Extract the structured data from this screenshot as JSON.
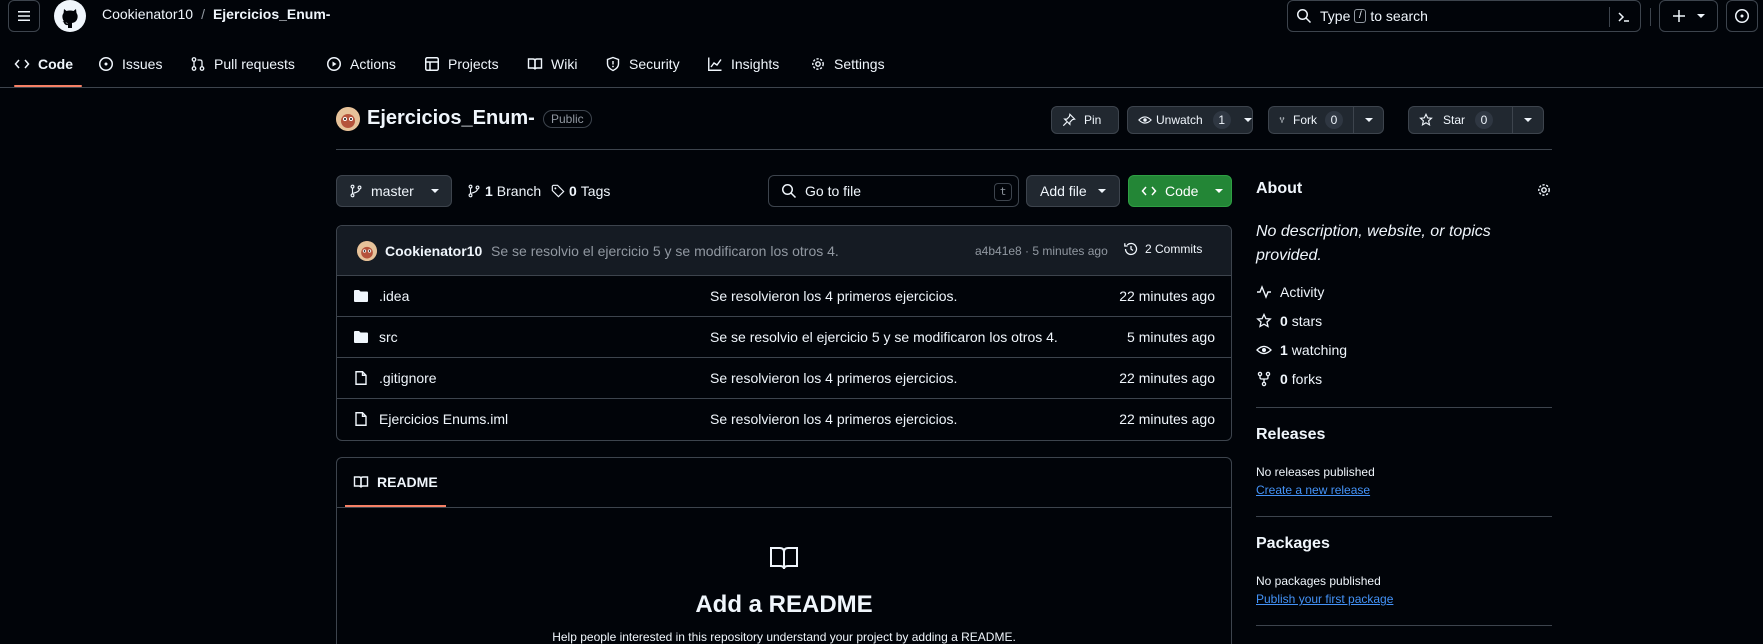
{
  "header": {
    "owner": "Cookienator10",
    "separator": "/",
    "repo": "Ejercicios_Enum-",
    "search": {
      "prefix": "Type",
      "key": "/",
      "suffix": "to search"
    }
  },
  "tabs": [
    {
      "label": "Code",
      "icon": "code-icon"
    },
    {
      "label": "Issues",
      "icon": "issue-opened-icon"
    },
    {
      "label": "Pull requests",
      "icon": "git-pull-request-icon"
    },
    {
      "label": "Actions",
      "icon": "play-icon"
    },
    {
      "label": "Projects",
      "icon": "table-icon"
    },
    {
      "label": "Wiki",
      "icon": "book-icon"
    },
    {
      "label": "Security",
      "icon": "shield-icon"
    },
    {
      "label": "Insights",
      "icon": "graph-icon"
    },
    {
      "label": "Settings",
      "icon": "gear-icon"
    }
  ],
  "repo": {
    "name": "Ejercicios_Enum-",
    "visibility": "Public",
    "pin_label": "Pin",
    "watch_label": "Unwatch",
    "watch_count": "1",
    "fork_label": "Fork",
    "fork_count": "0",
    "star_label": "Star",
    "star_count": "0"
  },
  "filenav": {
    "branch": "master",
    "branch_count": "1",
    "branch_label": "Branch",
    "tag_count": "0",
    "tag_label": "Tags",
    "goto_placeholder": "Go to file",
    "goto_key": "t",
    "add_file": "Add file",
    "code": "Code"
  },
  "commit": {
    "author": "Cookienator10",
    "message": "Se se resolvio el ejercicio 5 y se modificaron los otros 4.",
    "meta": "a4b41e8 · 5 minutes ago",
    "count": "2 Commits"
  },
  "files": [
    {
      "type": "folder",
      "name": ".idea",
      "message": "Se resolvieron los 4 primeros ejercicios.",
      "time": "22 minutes ago"
    },
    {
      "type": "folder",
      "name": "src",
      "message": "Se se resolvio el ejercicio 5 y se modificaron los otros 4.",
      "time": "5 minutes ago"
    },
    {
      "type": "file",
      "name": ".gitignore",
      "message": "Se resolvieron los 4 primeros ejercicios.",
      "time": "22 minutes ago"
    },
    {
      "type": "file",
      "name": "Ejercicios Enums.iml",
      "message": "Se resolvieron los 4 primeros ejercicios.",
      "time": "22 minutes ago"
    }
  ],
  "readme": {
    "tab": "README",
    "title": "Add a README",
    "help": "Help people interested in this repository understand your project by adding a README."
  },
  "about": {
    "title": "About",
    "description": "No description, website, or topics provided.",
    "activity": "Activity",
    "stars_count": "0",
    "stars_label": "stars",
    "watching_count": "1",
    "watching_label": "watching",
    "forks_count": "0",
    "forks_label": "forks"
  },
  "releases": {
    "title": "Releases",
    "empty": "No releases published",
    "link": "Create a new release"
  },
  "packages": {
    "title": "Packages",
    "empty": "No packages published",
    "link": "Publish your first package"
  },
  "colors": {
    "accent_underline": "#f78166",
    "primary_button": "#238636",
    "link": "#4493f8",
    "background": "#010409"
  }
}
